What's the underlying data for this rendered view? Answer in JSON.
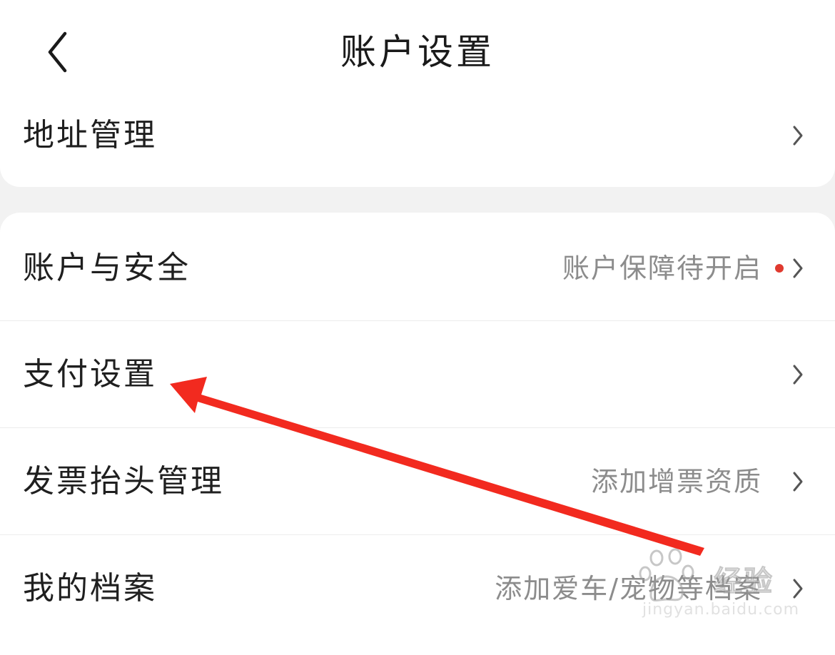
{
  "header": {
    "title": "账户设置",
    "back_icon": "chevron-left-icon"
  },
  "sections": [
    {
      "items": [
        {
          "label": "地址管理",
          "value": "",
          "icon": "chevron-right-icon"
        }
      ]
    },
    {
      "items": [
        {
          "label": "账户与安全",
          "value": "账户保障待开启",
          "badge": "red-dot",
          "icon": "chevron-right-icon"
        },
        {
          "label": "支付设置",
          "value": "",
          "icon": "chevron-right-icon"
        },
        {
          "label": "发票抬头管理",
          "value": "添加增票资质",
          "icon": "chevron-right-icon"
        },
        {
          "label": "我的档案",
          "value": "添加爱车/宠物等档案",
          "icon": "chevron-right-icon"
        }
      ]
    }
  ],
  "annotation": {
    "type": "red-arrow",
    "target": "支付设置",
    "color": "#f22a1f"
  },
  "watermark": {
    "brand": "经验",
    "url": "jingyan.baidu.com",
    "icon": "baidu-paw-icon"
  },
  "colors": {
    "background": "#f2f2f2",
    "card": "#ffffff",
    "label": "#1f1f1f",
    "secondary": "#8c8c8c",
    "divider": "#ececec",
    "badge": "#e03a2f",
    "arrow": "#f22a1f"
  }
}
